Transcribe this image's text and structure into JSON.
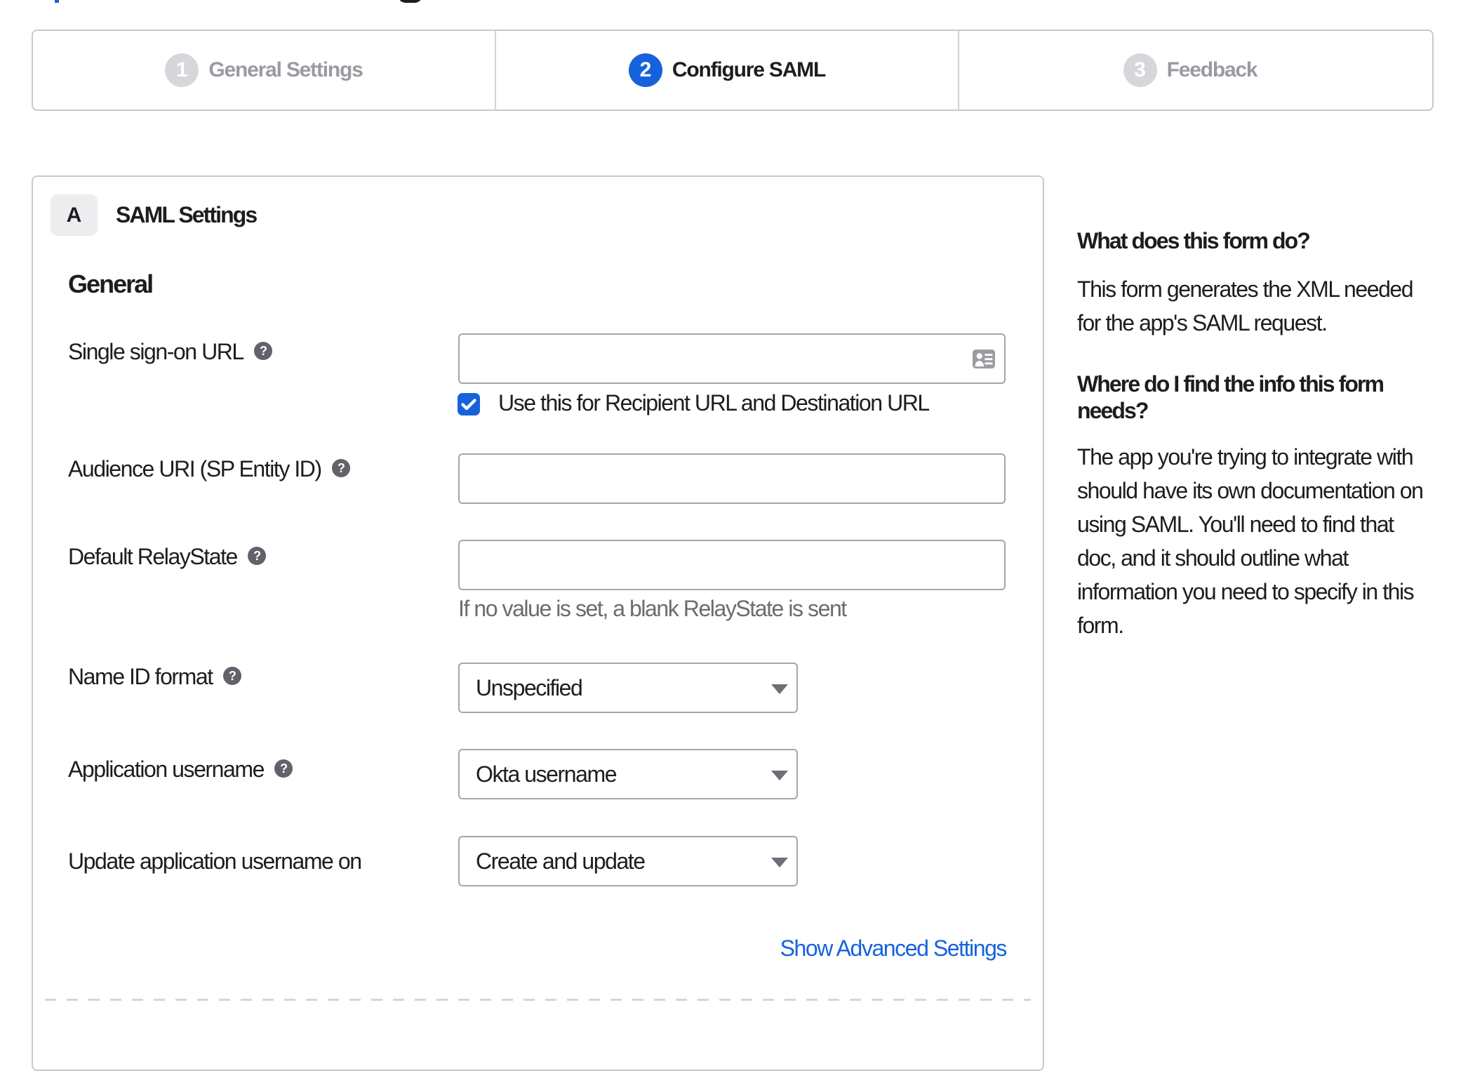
{
  "colors": {
    "primary_blue": "#1662dd",
    "text_dark": "#1d1d21",
    "text_gray": "#9595a0",
    "helper_gray": "#6b6b73",
    "border_light": "#c9c9cd",
    "border_input": "#a5a5ab"
  },
  "stepper": {
    "steps": [
      {
        "number": "1",
        "label": "General Settings",
        "state": "inactive"
      },
      {
        "number": "2",
        "label": "Configure SAML",
        "state": "active"
      },
      {
        "number": "3",
        "label": "Feedback",
        "state": "inactive"
      }
    ]
  },
  "panel": {
    "section_badge": "A",
    "section_title": "SAML Settings",
    "group_title": "General",
    "fields": [
      {
        "label": "Single sign-on URL",
        "has_help": true,
        "type": "text-input",
        "value": "",
        "trailing_icon": "address-card-icon",
        "checkbox": {
          "checked": true,
          "label": "Use this for Recipient URL and Destination URL"
        }
      },
      {
        "label": "Audience URI (SP Entity ID)",
        "has_help": true,
        "type": "text-input",
        "value": ""
      },
      {
        "label": "Default RelayState",
        "has_help": true,
        "type": "text-input",
        "value": "",
        "helper": "If no value is set, a blank RelayState is sent"
      },
      {
        "label": "Name ID format",
        "has_help": true,
        "type": "select",
        "value": "Unspecified"
      },
      {
        "label": "Application username",
        "has_help": true,
        "type": "select",
        "value": "Okta username"
      },
      {
        "label": "Update application username on",
        "has_help": false,
        "type": "select",
        "value": "Create and update"
      }
    ],
    "advanced_link": "Show Advanced Settings"
  },
  "sidebar": {
    "heading1": "What does this form do?",
    "paragraph1_lines": [
      "This form generates the XML needed",
      "for the app's SAML request."
    ],
    "heading2_lines": [
      "Where do I find the info this form",
      "needs?"
    ],
    "paragraph2_lines": [
      "The app you're trying to integrate with",
      "should have its own documentation on",
      "using SAML. You'll need to find that",
      "doc, and it should outline what",
      "information you need to specify in this",
      "form."
    ]
  }
}
